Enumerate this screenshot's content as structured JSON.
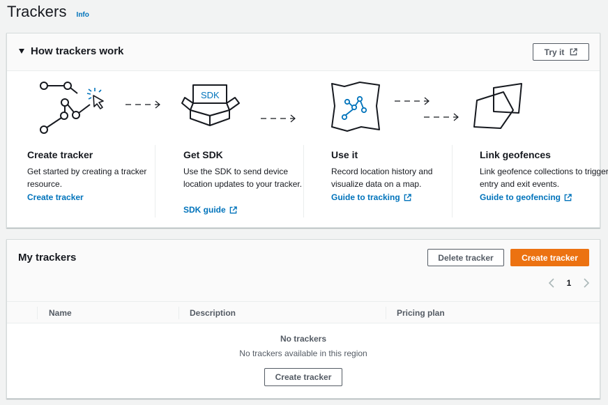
{
  "page": {
    "title": "Trackers",
    "info_label": "Info"
  },
  "how": {
    "title": "How trackers work",
    "try_label": "Try it",
    "steps": [
      {
        "title": "Create tracker",
        "desc": "Get started by creating a tracker resource.",
        "link": "Create tracker",
        "icon": "tracker-cursor-icon"
      },
      {
        "title": "Get SDK",
        "desc": "Use the SDK to send device location updates to your tracker.",
        "link": "SDK guide",
        "icon_text": "SDK",
        "icon": "sdk-box-icon"
      },
      {
        "title": "Use it",
        "desc": "Record location history and visualize data on a map.",
        "link": "Guide to tracking",
        "icon": "map-route-icon"
      },
      {
        "title": "Link geofences",
        "desc": "Link geofence collections to trigger entry and exit events.",
        "link": "Guide to geofencing",
        "icon": "geofence-shapes-icon"
      }
    ]
  },
  "trackers": {
    "title": "My trackers",
    "delete_label": "Delete tracker",
    "create_label": "Create tracker",
    "page_number": "1",
    "columns": [
      "Name",
      "Description",
      "Pricing plan"
    ],
    "empty_title": "No trackers",
    "empty_desc": "No trackers available in this region",
    "empty_button": "Create tracker"
  },
  "colors": {
    "link": "#0073bb",
    "primary": "#ec7211",
    "text": "#16191f",
    "muted": "#545b64"
  }
}
